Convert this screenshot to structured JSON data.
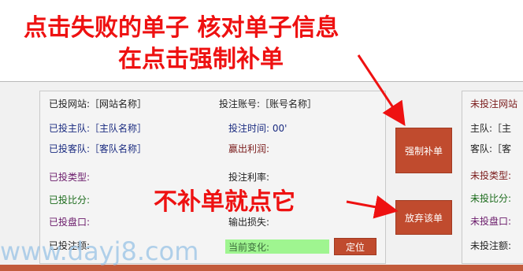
{
  "annotations": {
    "line1": "点击失败的单子  核对单子信息",
    "line2": "在点击强制补单",
    "line3": "不补单就点它"
  },
  "watermark": "www.dayj8.com",
  "left_panel": {
    "site": "已投网站:［网站名称］",
    "account": "投注账号:［账号名称］",
    "home_team": "已投主队:［主队名称］",
    "bet_time": "投注时间: 00'",
    "away_team": "已投客队:［客队名称］",
    "profit_loss": "赢出利润:",
    "bet_type": "已投类型:",
    "bet_rate": "投注利率:",
    "bet_ratio": "已投比分:",
    "market": "已投盘口:",
    "loss": "输出损失:",
    "bet_amount": "已投注额:",
    "current_change": "当前变化:",
    "locate_button": "定位"
  },
  "buttons": {
    "force": "强制补单",
    "abandon": "放弃该单"
  },
  "right_panel": {
    "site": "未投注网站",
    "home": "主队:［主",
    "away": "客队:［客",
    "type": "未投类型:",
    "ratio": "未投比分:",
    "market": "未投盘口:",
    "amount": "未投注额:"
  }
}
